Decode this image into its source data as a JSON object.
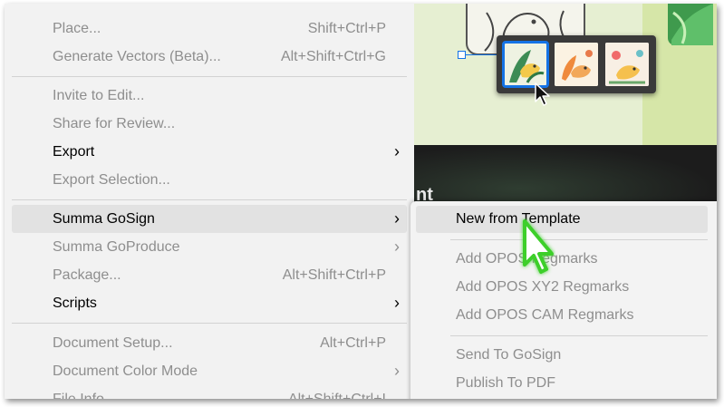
{
  "menu": {
    "items": [
      {
        "label": "Place...",
        "shortcut": "Shift+Ctrl+P",
        "enabled": false
      },
      {
        "label": "Generate Vectors (Beta)...",
        "shortcut": "Alt+Shift+Ctrl+G",
        "enabled": false
      },
      {
        "label": "Invite to Edit...",
        "shortcut": "",
        "enabled": false
      },
      {
        "label": "Share for Review...",
        "shortcut": "",
        "enabled": false
      },
      {
        "label": "Export",
        "shortcut": "",
        "enabled": true
      },
      {
        "label": "Export Selection...",
        "shortcut": "",
        "enabled": false
      },
      {
        "label": "Summa GoSign",
        "shortcut": "",
        "enabled": true
      },
      {
        "label": "Summa GoProduce",
        "shortcut": "",
        "enabled": false
      },
      {
        "label": "Package...",
        "shortcut": "Alt+Shift+Ctrl+P",
        "enabled": false
      },
      {
        "label": "Scripts",
        "shortcut": "",
        "enabled": true
      },
      {
        "label": "Document Setup...",
        "shortcut": "Alt+Ctrl+P",
        "enabled": false
      },
      {
        "label": "Document Color Mode",
        "shortcut": "",
        "enabled": false
      },
      {
        "label": "File Info...",
        "shortcut": "Alt+Shift+Ctrl+I",
        "enabled": false
      }
    ],
    "submenu_arrow": "›"
  },
  "submenu": {
    "items": [
      {
        "label": "New from Template",
        "enabled": true
      },
      {
        "label": "Add OPOS Regmarks",
        "enabled": false
      },
      {
        "label": "Add OPOS XY2 Regmarks",
        "enabled": false
      },
      {
        "label": "Add OPOS CAM Regmarks",
        "enabled": false
      },
      {
        "label": "Send To GoSign",
        "enabled": false
      },
      {
        "label": "Publish To PDF",
        "enabled": false
      }
    ]
  },
  "canvas": {
    "partial_text": "nt"
  },
  "icons": {
    "submenu_arrow": "chevron-right-icon",
    "cursor_highlighted": "pointer-cursor-icon",
    "cursor": "arrow-cursor-icon"
  },
  "colors": {
    "menu_bg": "#f2f2f2",
    "hover_bg": "#e2e2e2",
    "disabled_text": "#8e8e8e",
    "selection_blue": "#1473e6",
    "cursor_glow": "#3ecf2b"
  }
}
